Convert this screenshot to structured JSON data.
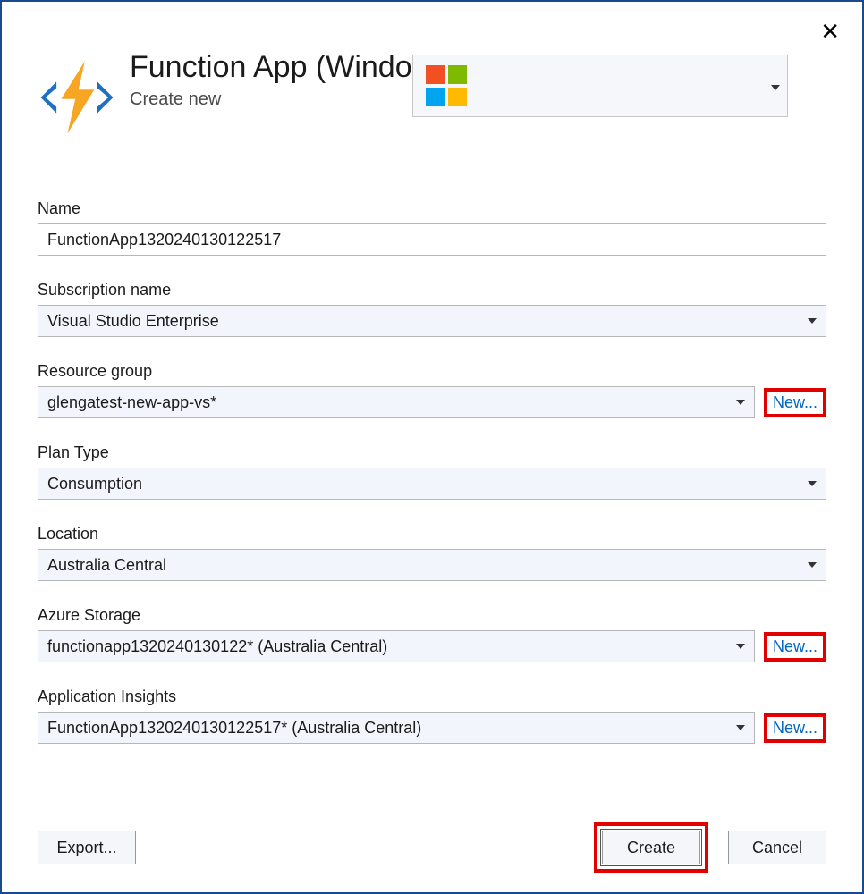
{
  "header": {
    "title": "Function App (Windo",
    "subtitle": "Create new"
  },
  "fields": {
    "name": {
      "label": "Name",
      "value": "FunctionApp1320240130122517"
    },
    "subscription": {
      "label": "Subscription name",
      "value": "Visual Studio Enterprise"
    },
    "resourceGroup": {
      "label": "Resource group",
      "value": "glengatest-new-app-vs*",
      "newLabel": "New..."
    },
    "planType": {
      "label": "Plan Type",
      "value": "Consumption"
    },
    "location": {
      "label": "Location",
      "value": "Australia Central"
    },
    "storage": {
      "label": "Azure Storage",
      "value": "functionapp1320240130122* (Australia Central)",
      "newLabel": "New..."
    },
    "appInsights": {
      "label": "Application Insights",
      "value": "FunctionApp1320240130122517* (Australia Central)",
      "newLabel": "New..."
    }
  },
  "footer": {
    "exportLabel": "Export...",
    "createLabel": "Create",
    "cancelLabel": "Cancel"
  }
}
